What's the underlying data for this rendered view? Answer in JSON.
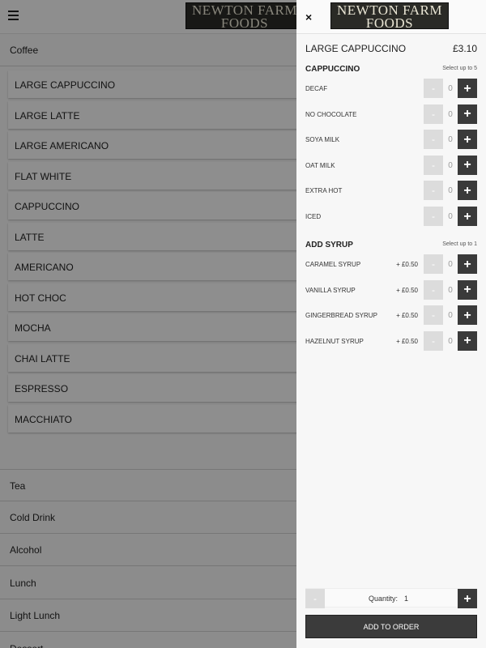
{
  "brand": {
    "line1": "NEWTON FARM",
    "line2": "FOODS"
  },
  "menu": {
    "open_category": "Coffee",
    "coffee_items": [
      "LARGE CAPPUCCINO",
      "LARGE LATTE",
      "LARGE AMERICANO",
      "FLAT WHITE",
      "CAPPUCCINO",
      "LATTE",
      "AMERICANO",
      "HOT CHOC",
      "MOCHA",
      "CHAI LATTE",
      "ESPRESSO",
      "MACCHIATO"
    ],
    "other_categories": [
      "Tea",
      "Cold Drink",
      "Alcohol",
      "Lunch",
      "Light Lunch",
      "Dessert"
    ]
  },
  "drawer": {
    "close": "×",
    "product_name": "LARGE CAPPUCCINO",
    "product_price": "£3.10",
    "groups": [
      {
        "title": "CAPPUCCINO",
        "note": "Select up to 5",
        "options": [
          {
            "label": "DECAF",
            "price": "",
            "count": "0"
          },
          {
            "label": "NO CHOCOLATE",
            "price": "",
            "count": "0"
          },
          {
            "label": "SOYA MILK",
            "price": "",
            "count": "0"
          },
          {
            "label": "OAT MILK",
            "price": "",
            "count": "0"
          },
          {
            "label": "EXTRA HOT",
            "price": "",
            "count": "0"
          },
          {
            "label": "ICED",
            "price": "",
            "count": "0"
          }
        ]
      },
      {
        "title": "ADD SYRUP",
        "note": "Select up to 1",
        "options": [
          {
            "label": "CARAMEL SYRUP",
            "price": "+ £0.50",
            "count": "0"
          },
          {
            "label": "VANILLA SYRUP",
            "price": "+ £0.50",
            "count": "0"
          },
          {
            "label": "GINGERBREAD SYRUP",
            "price": "+ £0.50",
            "count": "0"
          },
          {
            "label": "HAZELNUT SYRUP",
            "price": "+ £0.50",
            "count": "0"
          }
        ]
      }
    ],
    "minus_symbol": "-",
    "plus_symbol": "+",
    "quantity_label": "Quantity:",
    "quantity_value": "1",
    "add_button": "ADD TO ORDER"
  }
}
